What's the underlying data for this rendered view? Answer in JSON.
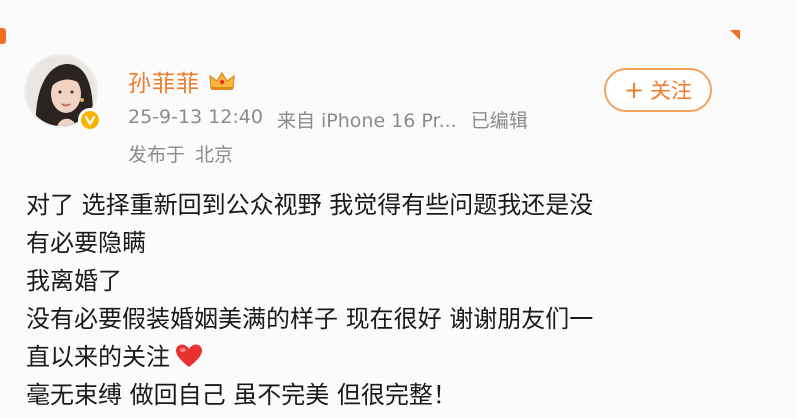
{
  "user": {
    "name": "孙菲菲",
    "timestamp": "25-9-13 12:40",
    "source": "来自 iPhone 16 Pr...",
    "edited": "已编辑",
    "location_prefix": "发布于",
    "location": "北京"
  },
  "follow_button": {
    "plus": "+",
    "label": "关注"
  },
  "post": {
    "lines": [
      "对了 选择重新回到公众视野 我觉得有些问题我还是没",
      "有必要隐瞒",
      "我离婚了",
      "没有必要假装婚姻美满的样子 现在很好 谢谢朋友们一",
      "直以来的关注",
      "毫无束缚 做回自己 虽不完美 但很完整！"
    ]
  },
  "icons": {
    "crown": "crown-badge-icon",
    "verified": "verified-v-icon",
    "heart": "red-heart-emoji-icon"
  },
  "colors": {
    "accent": "#ef7c2b",
    "meta_text": "#8b8b8b",
    "body_text": "#1a1a1a",
    "heart": "#e8322f"
  }
}
